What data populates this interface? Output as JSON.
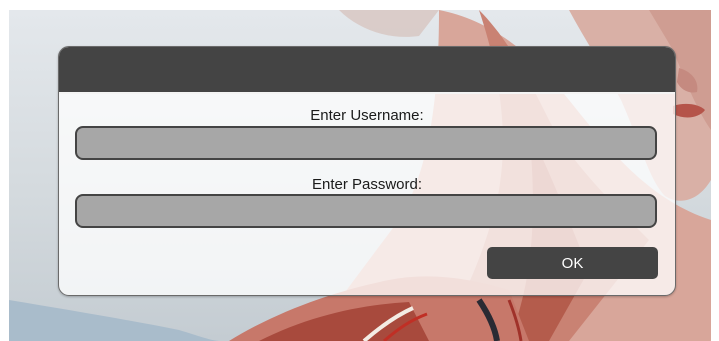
{
  "login_dialog": {
    "username_label": "Enter Username:",
    "username_value": "",
    "password_label": "Enter Password:",
    "password_value": "",
    "ok_label": "OK"
  },
  "colors": {
    "dialog_header": "#444444",
    "field_fill": "#a7a7a7",
    "field_border": "#444444",
    "button_fill": "#444444",
    "button_text": "#ffffff"
  }
}
